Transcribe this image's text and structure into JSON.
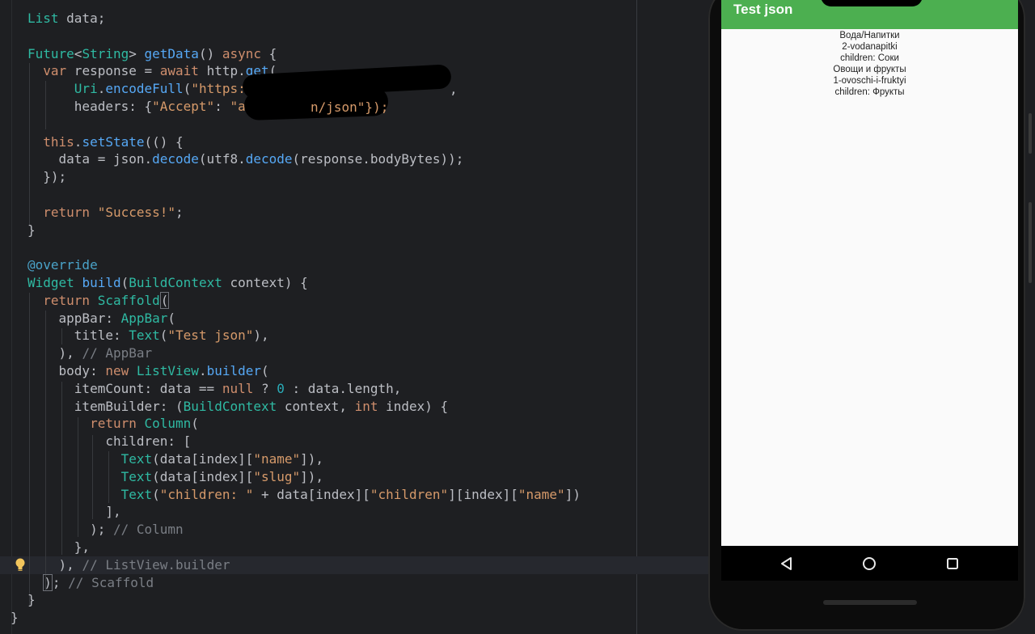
{
  "editor": {
    "code_lines": [
      [
        [
          "ty",
          "List"
        ],
        [
          "",
          " data;"
        ]
      ],
      [],
      [
        [
          "ty",
          "Future"
        ],
        [
          "",
          "<"
        ],
        [
          "ty",
          "String"
        ],
        [
          "",
          "> "
        ],
        [
          "fn",
          "getData"
        ],
        [
          "",
          "() "
        ],
        [
          "kw",
          "async"
        ],
        [
          "",
          " {"
        ]
      ],
      [
        [
          "",
          "  "
        ],
        [
          "kw",
          "var"
        ],
        [
          "",
          " response = "
        ],
        [
          "kw",
          "await"
        ],
        [
          "",
          " http."
        ],
        [
          "fn",
          "get"
        ],
        [
          "",
          "("
        ]
      ],
      [
        [
          "",
          "      "
        ],
        [
          "ty",
          "Uri"
        ],
        [
          "",
          "."
        ],
        [
          "fn",
          "encodeFull"
        ],
        [
          "",
          "("
        ],
        [
          "str",
          "\"https:/"
        ]
      ],
      [
        [
          "",
          "      headers: {"
        ],
        [
          "str",
          "\"Accept\""
        ],
        [
          "",
          ": "
        ],
        [
          "str",
          "\"a"
        ]
      ],
      [],
      [
        [
          "",
          "  "
        ],
        [
          "kw",
          "this"
        ],
        [
          "",
          "."
        ],
        [
          "fn",
          "setState"
        ],
        [
          "",
          "(() {"
        ]
      ],
      [
        [
          "",
          "    data = json."
        ],
        [
          "fn",
          "decode"
        ],
        [
          "",
          "(utf8."
        ],
        [
          "fn",
          "decode"
        ],
        [
          "",
          "(response.bodyBytes));"
        ]
      ],
      [
        [
          "",
          "  });"
        ]
      ],
      [],
      [
        [
          "",
          "  "
        ],
        [
          "kw",
          "return"
        ],
        [
          "",
          " "
        ],
        [
          "str",
          "\"Success!\""
        ],
        [
          "",
          ";"
        ]
      ],
      [
        [
          "",
          "}"
        ]
      ],
      [],
      [
        [
          "an",
          "@override"
        ]
      ],
      [
        [
          "ty",
          "Widget"
        ],
        [
          "",
          " "
        ],
        [
          "fn",
          "build"
        ],
        [
          "",
          "("
        ],
        [
          "ty",
          "BuildContext"
        ],
        [
          "",
          " context) {"
        ]
      ],
      [
        [
          "",
          "  "
        ],
        [
          "kw",
          "return"
        ],
        [
          "",
          " "
        ],
        [
          "ty",
          "Scaffold"
        ],
        [
          "box",
          "("
        ]
      ],
      [
        [
          "",
          "    appBar: "
        ],
        [
          "ty",
          "AppBar"
        ],
        [
          "",
          "("
        ]
      ],
      [
        [
          "",
          "      title: "
        ],
        [
          "ty",
          "Text"
        ],
        [
          "",
          "("
        ],
        [
          "str",
          "\"Test json\""
        ],
        [
          "",
          "),"
        ]
      ],
      [
        [
          "",
          "    ), "
        ],
        [
          "cm",
          "// AppBar"
        ]
      ],
      [
        [
          "",
          "    body: "
        ],
        [
          "kw",
          "new"
        ],
        [
          "",
          " "
        ],
        [
          "ty",
          "ListView"
        ],
        [
          "",
          "."
        ],
        [
          "fn",
          "builder"
        ],
        [
          "",
          "("
        ]
      ],
      [
        [
          "",
          "      itemCount: data == "
        ],
        [
          "kw",
          "null"
        ],
        [
          "",
          " ? "
        ],
        [
          "num",
          "0"
        ],
        [
          "",
          " : data.length,"
        ]
      ],
      [
        [
          "",
          "      itemBuilder: ("
        ],
        [
          "ty",
          "BuildContext"
        ],
        [
          "",
          " context, "
        ],
        [
          "kw",
          "int"
        ],
        [
          "",
          " index) {"
        ]
      ],
      [
        [
          "",
          "        "
        ],
        [
          "kw",
          "return"
        ],
        [
          "",
          " "
        ],
        [
          "ty",
          "Column"
        ],
        [
          "",
          "("
        ]
      ],
      [
        [
          "",
          "          children: ["
        ]
      ],
      [
        [
          "",
          "            "
        ],
        [
          "ty",
          "Text"
        ],
        [
          "",
          "(data[index]["
        ],
        [
          "str",
          "\"name\""
        ],
        [
          "",
          "]),"
        ]
      ],
      [
        [
          "",
          "            "
        ],
        [
          "ty",
          "Text"
        ],
        [
          "",
          "(data[index]["
        ],
        [
          "str",
          "\"slug\""
        ],
        [
          "",
          "]),"
        ]
      ],
      [
        [
          "",
          "            "
        ],
        [
          "ty",
          "Text"
        ],
        [
          "",
          "("
        ],
        [
          "str",
          "\"children: \""
        ],
        [
          "",
          " + data[index]["
        ],
        [
          "str",
          "\"children\""
        ],
        [
          "",
          "][index]["
        ],
        [
          "str",
          "\"name\""
        ],
        [
          "",
          "])"
        ]
      ],
      [
        [
          "",
          "          ],"
        ]
      ],
      [
        [
          "",
          "        ); "
        ],
        [
          "cm",
          "// Column"
        ]
      ],
      [
        [
          "",
          "      },"
        ]
      ],
      [
        [
          "",
          "    ), "
        ],
        [
          "cm",
          "// ListView.builder"
        ]
      ],
      [
        [
          "",
          "  "
        ],
        [
          "box",
          ")"
        ],
        [
          "",
          "; "
        ],
        [
          "cm",
          "// Scaffold"
        ]
      ],
      [
        [
          "",
          "}"
        ]
      ]
    ],
    "redacted_text_1": "n/json\"});",
    "url_tail": ",",
    "closing_brace": "}"
  },
  "phone": {
    "appbar_title": "Test json",
    "list_items": [
      "Вода/Напитки",
      "2-vodanapitki",
      "children: Соки",
      "Овощи и фрукты",
      "1-ovoschi-i-fruktyi",
      "children: Фрукты"
    ],
    "nav": {
      "back_icon": "back-triangle-icon",
      "home_icon": "home-circle-icon",
      "recents_icon": "recents-square-icon"
    },
    "colors": {
      "appbar": "#4caf50",
      "screen": "#fafafa"
    }
  }
}
